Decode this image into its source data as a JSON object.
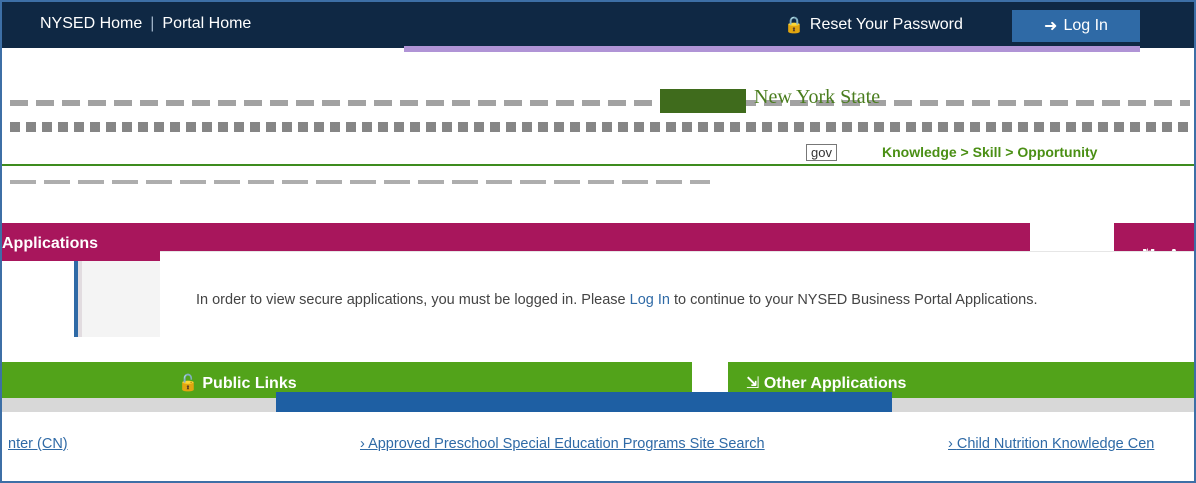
{
  "topbar": {
    "nysed_home": "NYSED Home",
    "separator": "|",
    "portal_home": "Portal Home",
    "reset_password": "Reset Your Password",
    "login_label": "Log In"
  },
  "header": {
    "agency_name": "New York State",
    "gov_tag": "gov",
    "slogan": "Knowledge > Skill > Opportunity"
  },
  "applications": {
    "banner_title": "Applications",
    "my_apps_label": "My A"
  },
  "notice": {
    "text_before": "In order to view secure applications, you must be logged in. Please ",
    "link_text": "Log In",
    "text_after": " to continue to your NYSED Business Portal Applications."
  },
  "sections": {
    "public_links_title": "Public Links",
    "other_apps_title": "Other Applications"
  },
  "links": {
    "col_a": "nter (CN)",
    "col_b": "Approved Preschool Special Education Programs Site Search",
    "col_c": "Child Nutrition Knowledge Cen"
  },
  "colors": {
    "topbar_bg": "#0f2844",
    "applications_banner": "#a8165c",
    "section_green": "#52a31a",
    "link_blue": "#2f6aa6"
  }
}
